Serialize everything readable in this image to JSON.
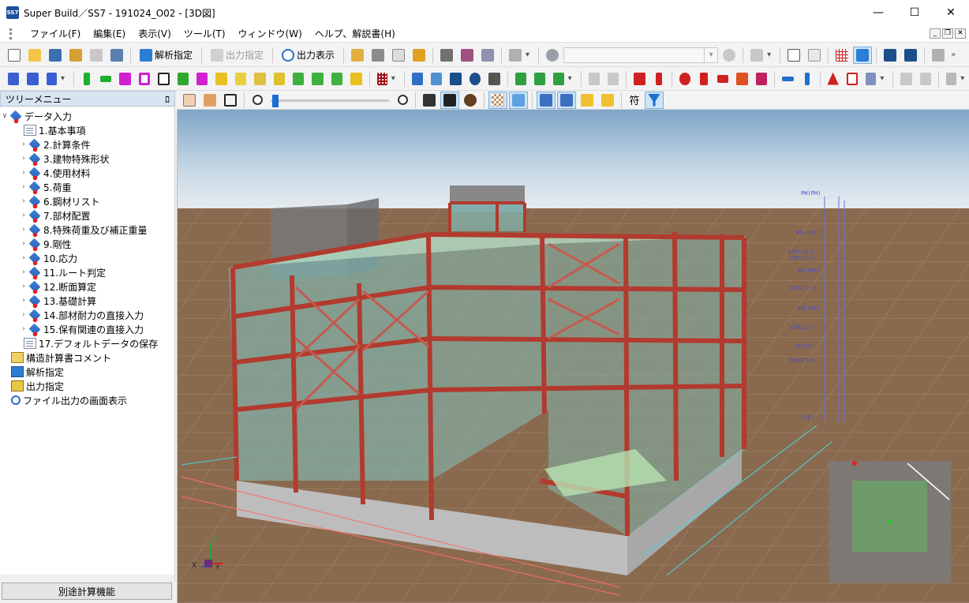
{
  "window": {
    "title": "Super Build／SS7 - 191024_O02 - [3D図]",
    "app_icon_text": "SS7",
    "minimize": "—",
    "maximize": "☐",
    "close": "✕"
  },
  "menu": {
    "items": [
      "ファイル(F)",
      "編集(E)",
      "表示(V)",
      "ツール(T)",
      "ウィンドウ(W)",
      "ヘルプ、解説書(H)"
    ],
    "mdi": [
      "_",
      "❐",
      "✕"
    ]
  },
  "toolbar1": {
    "kaiseki_label": "解析指定",
    "shutsuryoku_label": "出力指定",
    "hyoji_label": "出力表示"
  },
  "tree_panel": {
    "header": "ツリーメニュー",
    "pin": "ﾛ",
    "root": "データ入力",
    "items": [
      "1.基本事項",
      "2.計算条件",
      "3.建物特殊形状",
      "4.使用材料",
      "5.荷重",
      "6.鋼材リスト",
      "7.部材配置",
      "8.特殊荷重及び補正重量",
      "9.剛性",
      "10.応力",
      "11.ルート判定",
      "12.断面算定",
      "13.基礎計算",
      "14.部材耐力の直接入力",
      "15.保有関連の直接入力",
      "17.デフォルトデータの保存"
    ],
    "others": [
      "構造計算書コメント",
      "解析指定",
      "出力指定",
      "ファイル出力の画面表示"
    ],
    "bottom_button": "別途計算機能"
  },
  "viewbar": {
    "symbol_label": "符"
  },
  "viewport": {
    "axis_x": "X",
    "axis_y": "Y",
    "axis_z": "Z",
    "floor_labels": [
      "PH(PH)",
      "RFL(RF)",
      "14FL(4-)",
      "13FL(3-)",
      "4FL(4F)",
      "11FL(1-)",
      "3FL(3F)",
      "12FL(2-)",
      "2F(1F)",
      "5050(1F)",
      "(1F)"
    ]
  },
  "colors": {
    "frame_red": "#b23a2e",
    "glass": "#7fc6c4",
    "ground": "#8a6a4e",
    "sky_top": "#7fa6c8"
  }
}
